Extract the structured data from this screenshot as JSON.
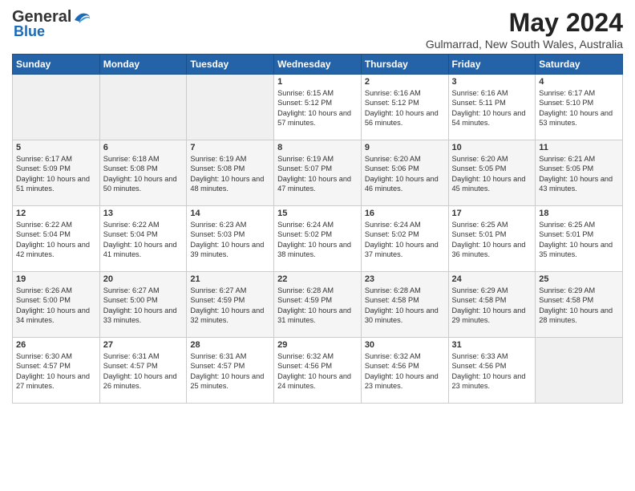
{
  "header": {
    "logo_general": "General",
    "logo_blue": "Blue",
    "month_title": "May 2024",
    "subtitle": "Gulmarrad, New South Wales, Australia"
  },
  "calendar": {
    "days_of_week": [
      "Sunday",
      "Monday",
      "Tuesday",
      "Wednesday",
      "Thursday",
      "Friday",
      "Saturday"
    ],
    "weeks": [
      [
        {
          "day": "",
          "info": ""
        },
        {
          "day": "",
          "info": ""
        },
        {
          "day": "",
          "info": ""
        },
        {
          "day": "1",
          "info": "Sunrise: 6:15 AM\nSunset: 5:12 PM\nDaylight: 10 hours and 57 minutes."
        },
        {
          "day": "2",
          "info": "Sunrise: 6:16 AM\nSunset: 5:12 PM\nDaylight: 10 hours and 56 minutes."
        },
        {
          "day": "3",
          "info": "Sunrise: 6:16 AM\nSunset: 5:11 PM\nDaylight: 10 hours and 54 minutes."
        },
        {
          "day": "4",
          "info": "Sunrise: 6:17 AM\nSunset: 5:10 PM\nDaylight: 10 hours and 53 minutes."
        }
      ],
      [
        {
          "day": "5",
          "info": "Sunrise: 6:17 AM\nSunset: 5:09 PM\nDaylight: 10 hours and 51 minutes."
        },
        {
          "day": "6",
          "info": "Sunrise: 6:18 AM\nSunset: 5:08 PM\nDaylight: 10 hours and 50 minutes."
        },
        {
          "day": "7",
          "info": "Sunrise: 6:19 AM\nSunset: 5:08 PM\nDaylight: 10 hours and 48 minutes."
        },
        {
          "day": "8",
          "info": "Sunrise: 6:19 AM\nSunset: 5:07 PM\nDaylight: 10 hours and 47 minutes."
        },
        {
          "day": "9",
          "info": "Sunrise: 6:20 AM\nSunset: 5:06 PM\nDaylight: 10 hours and 46 minutes."
        },
        {
          "day": "10",
          "info": "Sunrise: 6:20 AM\nSunset: 5:05 PM\nDaylight: 10 hours and 45 minutes."
        },
        {
          "day": "11",
          "info": "Sunrise: 6:21 AM\nSunset: 5:05 PM\nDaylight: 10 hours and 43 minutes."
        }
      ],
      [
        {
          "day": "12",
          "info": "Sunrise: 6:22 AM\nSunset: 5:04 PM\nDaylight: 10 hours and 42 minutes."
        },
        {
          "day": "13",
          "info": "Sunrise: 6:22 AM\nSunset: 5:04 PM\nDaylight: 10 hours and 41 minutes."
        },
        {
          "day": "14",
          "info": "Sunrise: 6:23 AM\nSunset: 5:03 PM\nDaylight: 10 hours and 39 minutes."
        },
        {
          "day": "15",
          "info": "Sunrise: 6:24 AM\nSunset: 5:02 PM\nDaylight: 10 hours and 38 minutes."
        },
        {
          "day": "16",
          "info": "Sunrise: 6:24 AM\nSunset: 5:02 PM\nDaylight: 10 hours and 37 minutes."
        },
        {
          "day": "17",
          "info": "Sunrise: 6:25 AM\nSunset: 5:01 PM\nDaylight: 10 hours and 36 minutes."
        },
        {
          "day": "18",
          "info": "Sunrise: 6:25 AM\nSunset: 5:01 PM\nDaylight: 10 hours and 35 minutes."
        }
      ],
      [
        {
          "day": "19",
          "info": "Sunrise: 6:26 AM\nSunset: 5:00 PM\nDaylight: 10 hours and 34 minutes."
        },
        {
          "day": "20",
          "info": "Sunrise: 6:27 AM\nSunset: 5:00 PM\nDaylight: 10 hours and 33 minutes."
        },
        {
          "day": "21",
          "info": "Sunrise: 6:27 AM\nSunset: 4:59 PM\nDaylight: 10 hours and 32 minutes."
        },
        {
          "day": "22",
          "info": "Sunrise: 6:28 AM\nSunset: 4:59 PM\nDaylight: 10 hours and 31 minutes."
        },
        {
          "day": "23",
          "info": "Sunrise: 6:28 AM\nSunset: 4:58 PM\nDaylight: 10 hours and 30 minutes."
        },
        {
          "day": "24",
          "info": "Sunrise: 6:29 AM\nSunset: 4:58 PM\nDaylight: 10 hours and 29 minutes."
        },
        {
          "day": "25",
          "info": "Sunrise: 6:29 AM\nSunset: 4:58 PM\nDaylight: 10 hours and 28 minutes."
        }
      ],
      [
        {
          "day": "26",
          "info": "Sunrise: 6:30 AM\nSunset: 4:57 PM\nDaylight: 10 hours and 27 minutes."
        },
        {
          "day": "27",
          "info": "Sunrise: 6:31 AM\nSunset: 4:57 PM\nDaylight: 10 hours and 26 minutes."
        },
        {
          "day": "28",
          "info": "Sunrise: 6:31 AM\nSunset: 4:57 PM\nDaylight: 10 hours and 25 minutes."
        },
        {
          "day": "29",
          "info": "Sunrise: 6:32 AM\nSunset: 4:56 PM\nDaylight: 10 hours and 24 minutes."
        },
        {
          "day": "30",
          "info": "Sunrise: 6:32 AM\nSunset: 4:56 PM\nDaylight: 10 hours and 23 minutes."
        },
        {
          "day": "31",
          "info": "Sunrise: 6:33 AM\nSunset: 4:56 PM\nDaylight: 10 hours and 23 minutes."
        },
        {
          "day": "",
          "info": ""
        }
      ]
    ]
  }
}
